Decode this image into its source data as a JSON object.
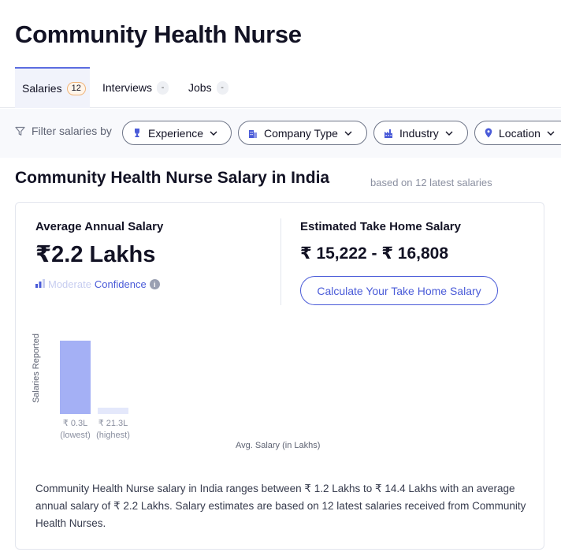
{
  "page": {
    "title": "Community Health Nurse"
  },
  "tabs": [
    {
      "label": "Salaries",
      "count": "12"
    },
    {
      "label": "Interviews",
      "count": "-"
    },
    {
      "label": "Jobs",
      "count": "-"
    }
  ],
  "filters": {
    "label": "Filter salaries by",
    "chips": [
      {
        "label": "Experience",
        "icon": "trophy-icon"
      },
      {
        "label": "Company Type",
        "icon": "building-icon"
      },
      {
        "label": "Industry",
        "icon": "factory-icon"
      },
      {
        "label": "Location",
        "icon": "location-pin-icon"
      }
    ]
  },
  "section": {
    "title": "Community Health Nurse Salary in India",
    "subtitle": "based on 12 latest salaries"
  },
  "card": {
    "avg_label": "Average Annual Salary",
    "avg_value": "₹2.2 Lakhs",
    "confidence_level": "Moderate",
    "confidence_label": "Confidence",
    "info_glyph": "i",
    "take_home_label": "Estimated Take Home Salary",
    "take_home_value": "₹ 15,222 - ₹ 16,808",
    "calc_button": "Calculate Your Take Home Salary",
    "description": "Community Health Nurse salary in India ranges between ₹ 1.2 Lakhs to ₹ 14.4 Lakhs with an average annual salary of ₹ 2.2 Lakhs. Salary estimates are based on 12 latest salaries received from Community Health Nurses."
  },
  "chart_data": {
    "type": "bar",
    "ylabel": "Salaries Reported",
    "xlabel": "Avg. Salary (in Lakhs)",
    "categories": [
      {
        "value_label": "₹ 0.3L",
        "note": "(lowest)"
      },
      {
        "value_label": "₹ 21.3L",
        "note": "(highest)"
      }
    ],
    "values": [
      11,
      1
    ],
    "colors": [
      "#a4b0f5",
      "#e4e8fb"
    ]
  },
  "colors": {
    "accent": "#4a5bd8",
    "orange_badge": "#f0b57a",
    "bar": "#a4b0f5"
  }
}
